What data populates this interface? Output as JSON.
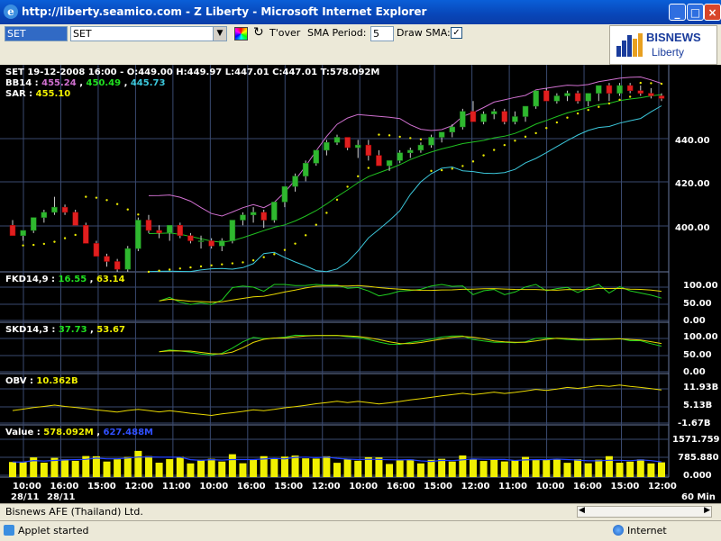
{
  "window": {
    "title": "http://liberty.seamico.com - Z Liberty - Microsoft Internet Explorer"
  },
  "toolbar": {
    "symbol_input": "SET",
    "symbol_select": "SET",
    "tover_label": "T'over",
    "sma_period_label": "SMA Period:",
    "sma_period_value": "5",
    "draw_sma_label": "Draw SMA:",
    "draw_sma_checked": "✓"
  },
  "logo": {
    "brand": "BISNEWS",
    "sub": "Liberty"
  },
  "price_panel": {
    "line1": "SET 19-12-2008 16:00 - O:449.00 H:449.97 L:447.01 C:447.01 T:578.092M",
    "bb_label": "BB14 :",
    "bb_upper": "455.24",
    "bb_mid": "450.49",
    "bb_lower": "445.73",
    "sar_label": "SAR :",
    "sar_value": "455.10",
    "y_ticks": [
      "440.00",
      "420.00",
      "400.00"
    ]
  },
  "fkd_panel": {
    "label": "FKD14,9 :",
    "v1": "16.55",
    "v2": "63.14",
    "y_ticks": [
      "100.00",
      "50.00",
      "0.00"
    ]
  },
  "skd_panel": {
    "label": "SKD14,3 :",
    "v1": "37.73",
    "v2": "53.67",
    "y_ticks": [
      "100.00",
      "50.00",
      "0.00"
    ]
  },
  "obv_panel": {
    "label": "OBV :",
    "value": "10.362B",
    "y_ticks": [
      "11.93B",
      "5.13B",
      "-1.67B"
    ]
  },
  "value_panel": {
    "label": "Value :",
    "v1": "578.092M",
    "v2": "627.488M",
    "y_ticks": [
      "1571.759",
      "785.880",
      "0.000"
    ]
  },
  "time_axis": {
    "labels": [
      "10:00",
      "16:00",
      "15:00",
      "12:00",
      "11:00",
      "10:00",
      "16:00",
      "15:00",
      "12:00",
      "10:00",
      "16:00",
      "15:00",
      "12:00",
      "11:00",
      "10:00",
      "16:00",
      "15:00",
      "12:00"
    ],
    "dates": [
      "28/11",
      "28/11"
    ],
    "interval": "60 Min"
  },
  "status": {
    "company": "Bisnews AFE (Thailand) Ltd.",
    "applet": "Applet started",
    "zone": "Internet"
  },
  "colors": {
    "up": "#2fb82f",
    "down": "#e01f1f",
    "bb_upper": "#d070d0",
    "bb_mid": "#20c020",
    "bb_lower": "#3cc8dc",
    "sar": "#e8e800",
    "label_yellow": "#f0f000"
  },
  "chart_data": {
    "type": "line",
    "title": "SET 60 Min",
    "price_candles": [
      [
        398,
        400,
        394,
        394
      ],
      [
        394,
        396,
        392,
        396
      ],
      [
        396,
        401,
        395,
        401
      ],
      [
        401,
        404,
        399,
        403
      ],
      [
        403,
        409,
        402,
        405
      ],
      [
        405,
        406,
        402,
        403
      ],
      [
        403,
        404,
        398,
        398
      ],
      [
        398,
        399,
        391,
        391
      ],
      [
        391,
        392,
        386,
        386
      ],
      [
        386,
        387,
        382,
        384
      ],
      [
        384,
        385,
        380,
        381
      ],
      [
        381,
        390,
        380,
        389
      ],
      [
        389,
        401,
        388,
        400
      ],
      [
        400,
        402,
        395,
        396
      ],
      [
        396,
        398,
        393,
        395
      ],
      [
        395,
        398,
        392,
        398
      ],
      [
        398,
        399,
        393,
        394
      ],
      [
        394,
        395,
        391,
        392
      ],
      [
        392,
        394,
        389,
        392
      ],
      [
        392,
        393,
        389,
        390
      ],
      [
        390,
        393,
        388,
        392
      ],
      [
        392,
        400,
        391,
        400
      ],
      [
        400,
        403,
        398,
        402
      ],
      [
        402,
        405,
        399,
        403
      ],
      [
        403,
        404,
        397,
        400
      ],
      [
        400,
        407,
        399,
        407
      ],
      [
        407,
        413,
        405,
        413
      ],
      [
        413,
        418,
        411,
        417
      ],
      [
        417,
        423,
        415,
        422
      ],
      [
        422,
        427,
        421,
        427
      ],
      [
        427,
        431,
        425,
        430
      ],
      [
        430,
        433,
        429,
        432
      ],
      [
        432,
        432,
        427,
        428
      ],
      [
        428,
        431,
        424,
        429
      ],
      [
        429,
        431,
        423,
        425
      ],
      [
        425,
        427,
        421,
        421
      ],
      [
        421,
        423,
        419,
        423
      ],
      [
        423,
        427,
        422,
        426
      ],
      [
        426,
        428,
        424,
        427
      ],
      [
        427,
        430,
        426,
        429
      ],
      [
        429,
        433,
        428,
        432
      ],
      [
        432,
        434,
        430,
        434
      ],
      [
        434,
        437,
        432,
        436
      ],
      [
        436,
        443,
        435,
        442
      ],
      [
        442,
        446,
        438,
        438
      ],
      [
        438,
        442,
        437,
        441
      ],
      [
        441,
        443,
        439,
        442
      ],
      [
        442,
        443,
        437,
        438
      ],
      [
        438,
        442,
        437,
        440
      ],
      [
        440,
        444,
        438,
        444
      ],
      [
        444,
        450,
        443,
        450
      ],
      [
        450,
        451,
        446,
        446
      ],
      [
        446,
        449,
        445,
        448
      ],
      [
        448,
        450,
        446,
        449
      ],
      [
        449,
        450,
        445,
        446
      ],
      [
        446,
        449,
        444,
        449
      ],
      [
        449,
        452,
        446,
        452
      ],
      [
        452,
        453,
        446,
        449
      ],
      [
        449,
        453,
        448,
        452
      ],
      [
        452,
        453,
        449,
        450
      ],
      [
        450,
        452,
        448,
        449
      ],
      [
        449,
        451,
        447,
        448
      ],
      [
        448,
        449,
        446,
        447
      ]
    ],
    "price_ylim": [
      380,
      460
    ],
    "fk_ylim": [
      0,
      100
    ],
    "obv_ylim": [
      -1.67,
      11.93
    ],
    "value_ylim": [
      0,
      1571.759
    ]
  }
}
